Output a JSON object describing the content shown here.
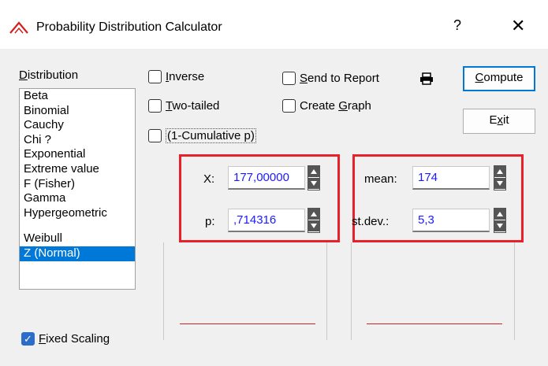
{
  "window": {
    "title": "Probability Distribution Calculator",
    "help": "?",
    "close": "✕"
  },
  "distribution": {
    "label_first": "D",
    "label_rest": "istribution",
    "items": [
      "Beta",
      "Binomial",
      "Cauchy",
      "Chi ?",
      "Exponential",
      "Extreme value",
      "F (Fisher)",
      "Gamma",
      "Hypergeometric",
      "Weibull",
      "Z (Normal)"
    ],
    "selected": "Z (Normal)"
  },
  "options": {
    "inverse": {
      "key": "I",
      "rest": "nverse",
      "checked": false
    },
    "two_tailed": {
      "key": "T",
      "rest": "wo-tailed",
      "checked": false
    },
    "one_minus_cumulative": {
      "text": "(1-Cumulative p)",
      "checked": false
    },
    "send_to_report": {
      "key": "S",
      "rest": "end to Report",
      "checked": false
    },
    "create_graph": {
      "pre": "Create ",
      "key": "G",
      "rest": "raph",
      "checked": false
    },
    "fixed_scaling": {
      "key": "F",
      "rest": "ixed Scaling",
      "checked": true
    }
  },
  "buttons": {
    "compute": {
      "key": "C",
      "rest": "ompute"
    },
    "exit": {
      "pre": "E",
      "key": "x",
      "rest": "it"
    }
  },
  "fields": {
    "x_label": "X:",
    "x_value": "177,00000",
    "p_label": "p:",
    "p_value": ",714316",
    "mean_label": "mean:",
    "mean_value": "174",
    "stdev_label": "st.dev.:",
    "stdev_value": "5,3"
  },
  "colors": {
    "selection": "#0078d7",
    "highlight_box": "#e8202a",
    "value_text": "#1a1aff",
    "graph_line": "#cc2222"
  }
}
